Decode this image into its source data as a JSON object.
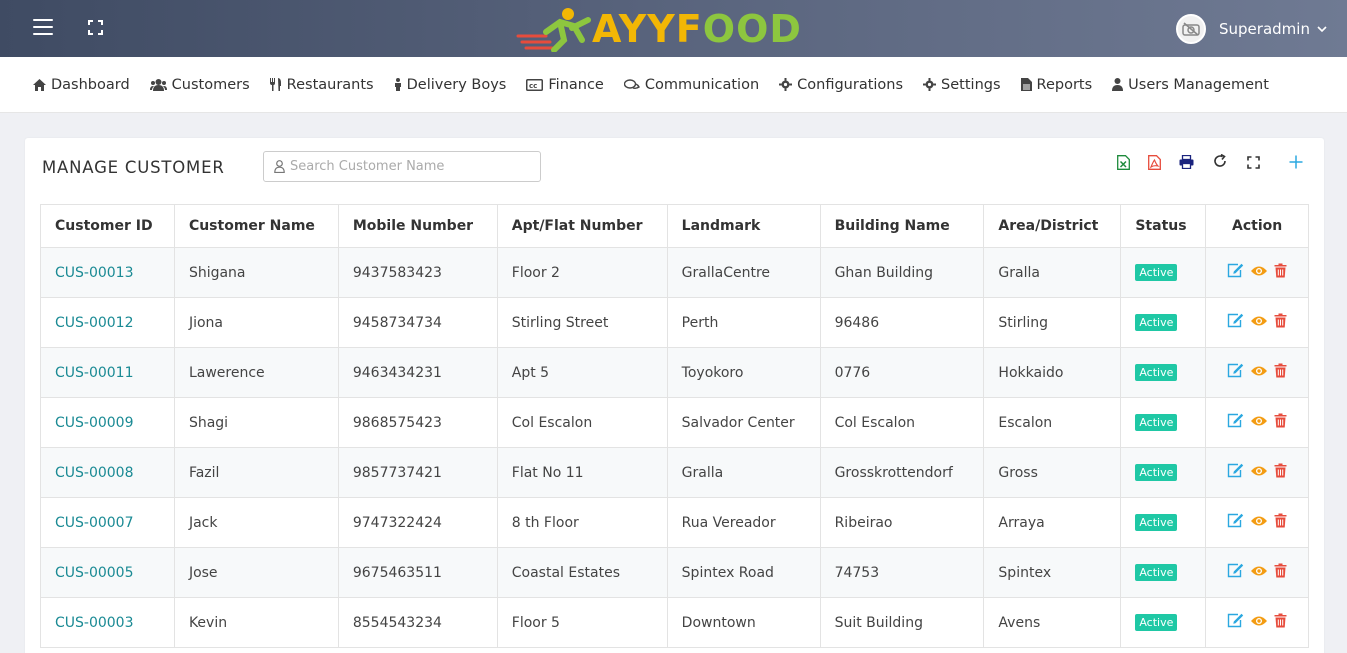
{
  "header": {
    "logo_text_a": "AYYF",
    "logo_text_o1": "O",
    "logo_text_o2": "O",
    "logo_text_d": "D",
    "user_name": "Superadmin"
  },
  "nav": {
    "items": [
      {
        "label": "Dashboard",
        "icon": "home-icon"
      },
      {
        "label": "Customers",
        "icon": "users-icon"
      },
      {
        "label": "Restaurants",
        "icon": "utensils-icon"
      },
      {
        "label": "Delivery Boys",
        "icon": "person-icon"
      },
      {
        "label": "Finance",
        "icon": "credit-card-icon"
      },
      {
        "label": "Communication",
        "icon": "chat-icon"
      },
      {
        "label": "Configurations",
        "icon": "cog-icon"
      },
      {
        "label": "Settings",
        "icon": "gear-icon"
      },
      {
        "label": "Reports",
        "icon": "file-icon"
      },
      {
        "label": "Users Management",
        "icon": "user-icon"
      }
    ]
  },
  "page": {
    "title": "MANAGE CUSTOMER",
    "search_placeholder": "Search Customer Name"
  },
  "colors": {
    "accent": "#1a8a94",
    "status_active": "#1fc8a5",
    "edit": "#2ba8e0",
    "view": "#f39c12",
    "delete": "#e74c3c"
  },
  "table": {
    "headers": [
      "Customer ID",
      "Customer Name",
      "Mobile Number",
      "Apt/Flat Number",
      "Landmark",
      "Building Name",
      "Area/District",
      "Status",
      "Action"
    ],
    "rows": [
      [
        "CUS-00013",
        "Shigana",
        "9437583423",
        "Floor 2",
        "GrallaCentre",
        "Ghan Building",
        "Gralla",
        "Active"
      ],
      [
        "CUS-00012",
        "Jiona",
        "9458734734",
        "Stirling Street",
        "Perth",
        "96486",
        "Stirling",
        "Active"
      ],
      [
        "CUS-00011",
        "Lawerence",
        "9463434231",
        "Apt 5",
        "Toyokoro",
        "0776",
        "Hokkaido",
        "Active"
      ],
      [
        "CUS-00009",
        "Shagi",
        "9868575423",
        "Col Escalon",
        "Salvador Center",
        "Col Escalon",
        "Escalon",
        "Active"
      ],
      [
        "CUS-00008",
        "Fazil",
        "9857737421",
        "Flat No 11",
        "Gralla",
        "Grosskrottendorf",
        "Gross",
        "Active"
      ],
      [
        "CUS-00007",
        "Jack",
        "9747322424",
        "8 th Floor",
        "Rua Vereador",
        "Ribeirao",
        "Arraya",
        "Active"
      ],
      [
        "CUS-00005",
        "Jose",
        "9675463511",
        "Coastal Estates",
        "Spintex Road",
        "74753",
        "Spintex",
        "Active"
      ],
      [
        "CUS-00003",
        "Kevin",
        "8554543234",
        "Floor 5",
        "Downtown",
        "Suit Building",
        "Avens",
        "Active"
      ]
    ]
  }
}
